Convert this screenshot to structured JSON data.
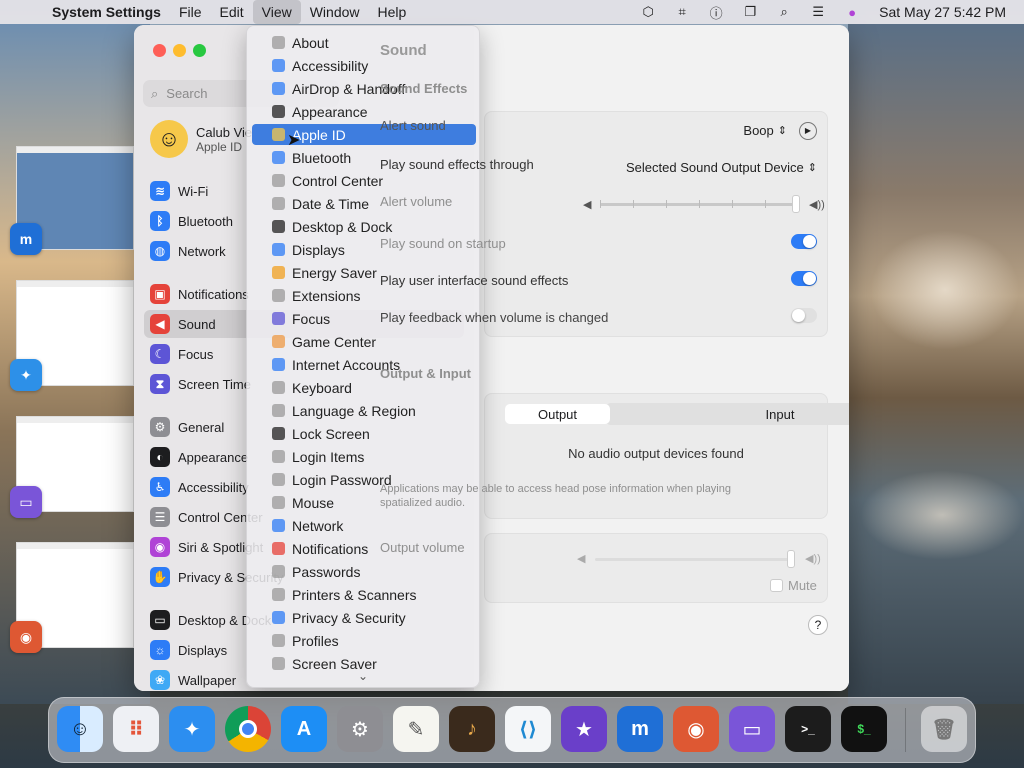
{
  "menubar": {
    "app": "System Settings",
    "menus": [
      "File",
      "Edit",
      "View",
      "Window",
      "Help"
    ],
    "active_menu": "View",
    "clock": "Sat May 27  5:42 PM"
  },
  "sidebar": {
    "search_placeholder": "Search",
    "profile": {
      "name": "Calub Viem",
      "sub": "Apple ID"
    },
    "items": [
      {
        "label": "Wi-Fi",
        "icon": "wifi-icon",
        "color": "#2d7cf6"
      },
      {
        "label": "Bluetooth",
        "icon": "bluetooth-icon",
        "color": "#2d7cf6"
      },
      {
        "label": "Network",
        "icon": "network-icon",
        "color": "#2d7cf6"
      },
      {
        "label": "Notifications",
        "icon": "bell-icon",
        "color": "#e5433a"
      },
      {
        "label": "Sound",
        "icon": "speaker-icon",
        "color": "#e5433a"
      },
      {
        "label": "Focus",
        "icon": "moon-icon",
        "color": "#5d55d6"
      },
      {
        "label": "Screen Time",
        "icon": "hourglass-icon",
        "color": "#5d55d6"
      },
      {
        "label": "General",
        "icon": "gear-icon",
        "color": "#8e8e93"
      },
      {
        "label": "Appearance",
        "icon": "appearance-icon",
        "color": "#1d1d1f"
      },
      {
        "label": "Accessibility",
        "icon": "accessibility-icon",
        "color": "#2d7cf6"
      },
      {
        "label": "Control Center",
        "icon": "control-center-icon",
        "color": "#8e8e93"
      },
      {
        "label": "Siri & Spotlight",
        "icon": "siri-icon",
        "color": "#b043d6"
      },
      {
        "label": "Privacy & Security",
        "icon": "hand-icon",
        "color": "#2d7cf6"
      },
      {
        "label": "Desktop & Dock",
        "icon": "dock-icon",
        "color": "#1d1d1f"
      },
      {
        "label": "Displays",
        "icon": "sun-icon",
        "color": "#2d7cf6"
      },
      {
        "label": "Wallpaper",
        "icon": "wallpaper-icon",
        "color": "#3fa9f5"
      }
    ],
    "selected": "Sound"
  },
  "content": {
    "title": "Sound",
    "sound_effects_header": "Sound Effects",
    "alert_sound_label": "Alert sound",
    "alert_sound_value": "Boop",
    "play_through_label": "Play sound effects through",
    "play_through_value": "Selected Sound Output Device",
    "alert_volume_label": "Alert volume",
    "startup_label": "Play sound on startup",
    "ui_effects_label": "Play user interface sound effects",
    "feedback_label": "Play feedback when volume is changed",
    "toggles": {
      "startup": true,
      "ui_effects": true,
      "feedback": false
    },
    "output_input_header": "Output & Input",
    "tab_output": "Output",
    "tab_input": "Input",
    "no_devices": "No audio output devices found",
    "head_pose_note": "Applications may be able to access head pose information when playing spatialized audio.",
    "output_volume_label": "Output volume",
    "mute_label": "Mute",
    "help_label": "?"
  },
  "view_menu": {
    "items": [
      "About",
      "Accessibility",
      "AirDrop & Handoff",
      "Appearance",
      "Apple ID",
      "Bluetooth",
      "Control Center",
      "Date & Time",
      "Desktop & Dock",
      "Displays",
      "Energy Saver",
      "Extensions",
      "Focus",
      "Game Center",
      "Internet Accounts",
      "Keyboard",
      "Language & Region",
      "Lock Screen",
      "Login Items",
      "Login Password",
      "Mouse",
      "Network",
      "Notifications",
      "Passwords",
      "Printers & Scanners",
      "Privacy & Security",
      "Profiles",
      "Screen Saver"
    ],
    "highlighted": "Apple ID"
  },
  "colors": {
    "accent": "#2d7cf6",
    "menu_highlight": "#3e7ddf",
    "toggle_on": "#2d7cf6",
    "toggle_off": "#e0e0e0"
  },
  "dock": [
    "Finder",
    "Launchpad",
    "Safari",
    "Chrome",
    "App Store",
    "System Settings",
    "TextEdit",
    "GarageBand",
    "VS Code",
    "iMovie",
    "Maxthon",
    "DuckDuckGo",
    "Disk Utility",
    "Terminal",
    "Terminal 2",
    "Trash"
  ]
}
